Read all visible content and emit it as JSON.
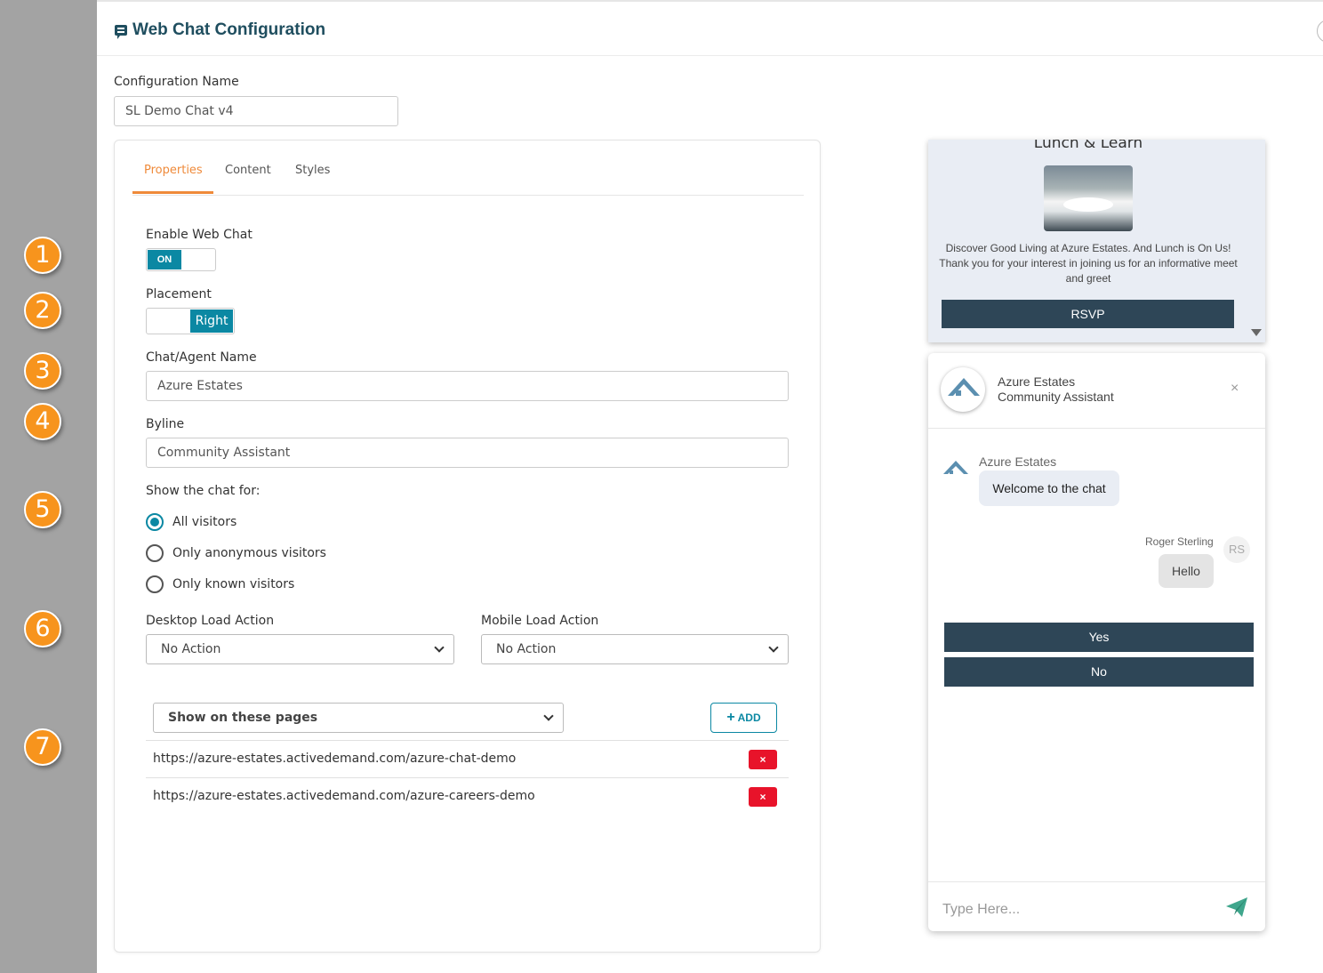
{
  "header": {
    "title": "Web Chat Configuration"
  },
  "callouts": [
    "1",
    "2",
    "3",
    "4",
    "5",
    "6",
    "7"
  ],
  "config": {
    "name_label": "Configuration Name",
    "name_value": "SL Demo Chat v4"
  },
  "tabs": [
    {
      "label": "Properties"
    },
    {
      "label": "Content"
    },
    {
      "label": "Styles"
    }
  ],
  "properties": {
    "enable_label": "Enable Web Chat",
    "enable_state": "ON",
    "placement_label": "Placement",
    "placement_value": "Right",
    "agent_name_label": "Chat/Agent Name",
    "agent_name_value": "Azure Estates",
    "byline_label": "Byline",
    "byline_value": "Community Assistant",
    "show_for_label": "Show the chat for:",
    "show_for_options": [
      "All visitors",
      "Only anonymous visitors",
      "Only known visitors"
    ],
    "show_for_selected": "All visitors",
    "desktop_label": "Desktop Load Action",
    "desktop_value": "No Action",
    "mobile_label": "Mobile Load Action",
    "mobile_value": "No Action",
    "pages_filter": "Show on these pages",
    "add_label": "ADD",
    "pages": [
      "https://azure-estates.activedemand.com/azure-chat-demo",
      "https://azure-estates.activedemand.com/azure-careers-demo"
    ],
    "delete_label": "×"
  },
  "preview": {
    "promo": {
      "title": "Lunch & Learn",
      "line1": "Discover Good Living at Azure Estates. And Lunch is On Us!",
      "line2": "Thank you for your interest in joining us for an informative meet and greet",
      "button": "RSVP"
    },
    "chat": {
      "name": "Azure Estates",
      "byline": "Community Assistant",
      "close": "×",
      "bot_name": "Azure Estates",
      "bot_message": "Welcome to the chat",
      "user_name": "Roger Sterling",
      "user_initials": "RS",
      "user_message": "Hello",
      "choices": [
        "Yes",
        "No"
      ],
      "input_placeholder": "Type Here..."
    }
  },
  "colors": {
    "accent": "#0b88a3",
    "tab_active": "#ef8a3a",
    "callout": "#f7941d",
    "dark_button": "#2e4657",
    "delete": "#e8132a"
  }
}
